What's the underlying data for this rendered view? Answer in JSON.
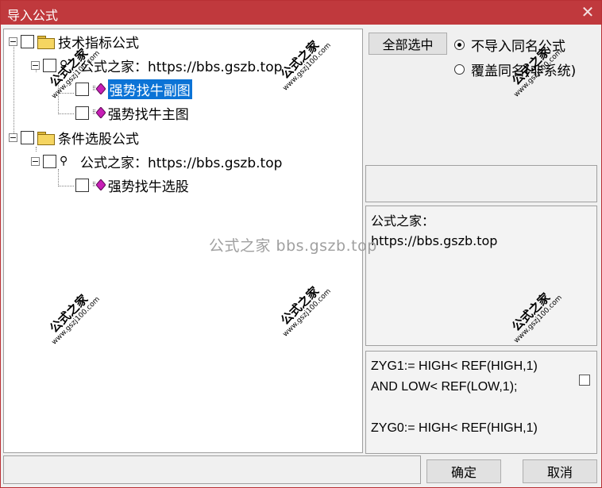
{
  "window": {
    "title": "导入公式",
    "close_glyph": "✕"
  },
  "tree": {
    "tech_group": "技术指标公式",
    "tech_source": "公式之家：https://bbs.gszb.top",
    "tech_items": [
      "强势找牛副图",
      "强势找牛主图"
    ],
    "select_group": "条件选股公式",
    "select_source": "公式之家：https://bbs.gszb.top",
    "select_items": [
      "强势找牛选股"
    ]
  },
  "controls": {
    "select_all_label": "全部选中",
    "radio_no_import": "不导入同名公式",
    "radio_overwrite": "覆盖同名(非系统)",
    "selected_radio": "no_import"
  },
  "description": {
    "line1": "公式之家：",
    "line2": "https://bbs.gszb.top"
  },
  "code": {
    "line1": "ZYG1:= HIGH< REF(HIGH,1)",
    "line2": "AND LOW< REF(LOW,1);",
    "line3": "",
    "line4": "ZYG0:= HIGH< REF(HIGH,1)"
  },
  "footer": {
    "ok_label": "确定",
    "cancel_label": "取消"
  },
  "watermark": {
    "center": "公式之家 bbs.gszb.top",
    "stamp_text": "公式之家",
    "stamp_url": "www.gszj100.com"
  },
  "colors": {
    "title_bar": "#c0393d",
    "selection": "#0b73d6"
  }
}
